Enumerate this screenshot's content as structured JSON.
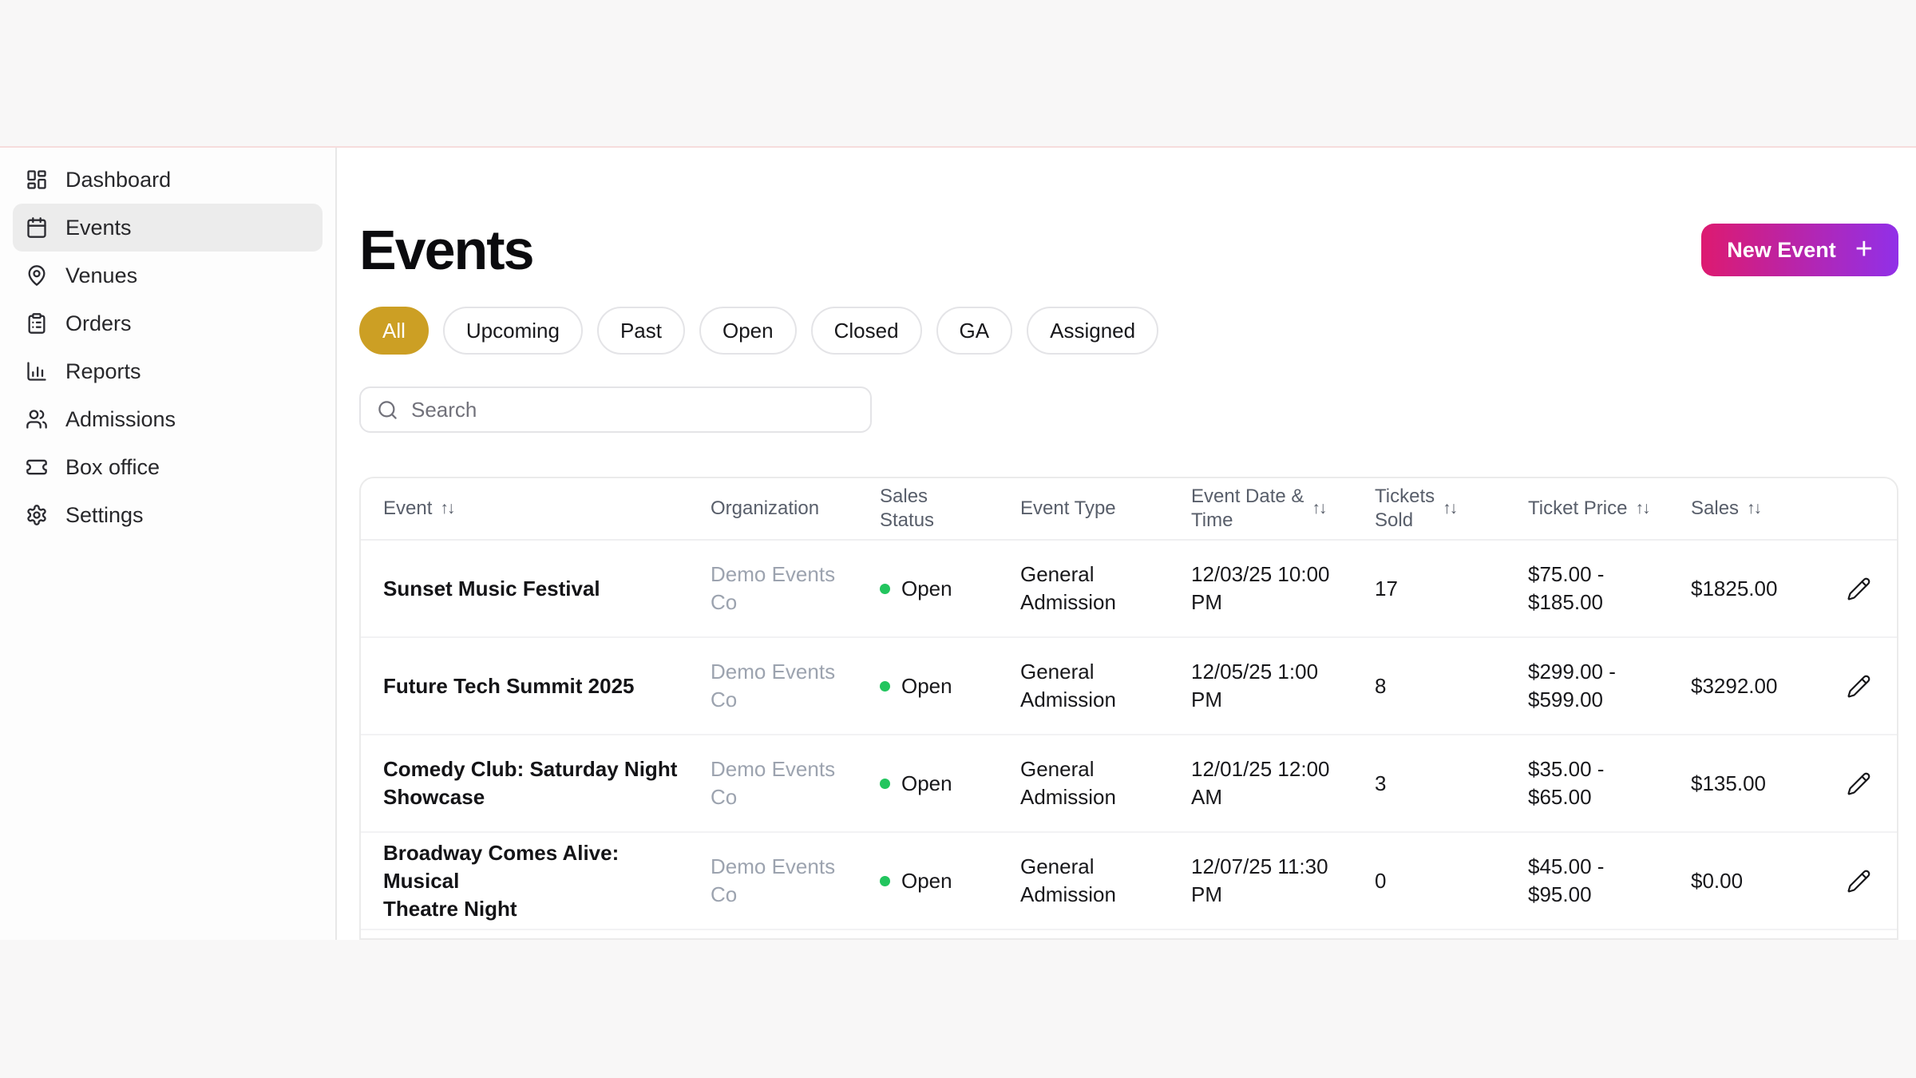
{
  "colors": {
    "accent_gold": "#cc9f24",
    "button_gradient_from": "#dd1a70",
    "button_gradient_to": "#9130e8",
    "status_open_green": "#22c55e",
    "top_divider_pink": "#f6dcdc"
  },
  "sidebar": {
    "items": [
      {
        "label": "Dashboard",
        "icon": "dashboard-icon",
        "active": false
      },
      {
        "label": "Events",
        "icon": "calendar-icon",
        "active": true
      },
      {
        "label": "Venues",
        "icon": "map-pin-icon",
        "active": false
      },
      {
        "label": "Orders",
        "icon": "clipboard-icon",
        "active": false
      },
      {
        "label": "Reports",
        "icon": "bar-chart-icon",
        "active": false
      },
      {
        "label": "Admissions",
        "icon": "users-icon",
        "active": false
      },
      {
        "label": "Box office",
        "icon": "ticket-icon",
        "active": false
      },
      {
        "label": "Settings",
        "icon": "gear-icon",
        "active": false
      }
    ]
  },
  "header": {
    "title": "Events",
    "new_event_label": "New Event",
    "new_event_plus": "+"
  },
  "filters": [
    {
      "label": "All",
      "active": true
    },
    {
      "label": "Upcoming",
      "active": false
    },
    {
      "label": "Past",
      "active": false
    },
    {
      "label": "Open",
      "active": false
    },
    {
      "label": "Closed",
      "active": false
    },
    {
      "label": "GA",
      "active": false
    },
    {
      "label": "Assigned",
      "active": false
    }
  ],
  "search": {
    "placeholder": "Search",
    "icon": "search-icon"
  },
  "table": {
    "sort_glyph": "↑↓",
    "columns": [
      {
        "label": "Event",
        "sortable": true
      },
      {
        "label": "Organization",
        "sortable": false
      },
      {
        "label": "Sales\nStatus",
        "sortable": false
      },
      {
        "label": "Event Type",
        "sortable": false
      },
      {
        "label": "Event Date &\nTime",
        "sortable": true
      },
      {
        "label": "Tickets\nSold",
        "sortable": true
      },
      {
        "label": "Ticket Price",
        "sortable": true
      },
      {
        "label": "Sales",
        "sortable": true
      }
    ],
    "rows": [
      {
        "event": "Sunset Music Festival",
        "organization": "Demo Events\nCo",
        "sales_status": "Open",
        "event_type": "General\nAdmission",
        "datetime": "12/03/25 10:00\nPM",
        "tickets_sold": "17",
        "ticket_price": "$75.00 -\n$185.00",
        "sales": "$1825.00"
      },
      {
        "event": "Future Tech Summit 2025",
        "organization": "Demo Events\nCo",
        "sales_status": "Open",
        "event_type": "General\nAdmission",
        "datetime": "12/05/25 1:00\nPM",
        "tickets_sold": "8",
        "ticket_price": "$299.00 -\n$599.00",
        "sales": "$3292.00"
      },
      {
        "event": "Comedy Club: Saturday Night\nShowcase",
        "organization": "Demo Events\nCo",
        "sales_status": "Open",
        "event_type": "General\nAdmission",
        "datetime": "12/01/25 12:00\nAM",
        "tickets_sold": "3",
        "ticket_price": "$35.00 -\n$65.00",
        "sales": "$135.00"
      },
      {
        "event": "Broadway Comes Alive: Musical\nTheatre Night",
        "organization": "Demo Events\nCo",
        "sales_status": "Open",
        "event_type": "General\nAdmission",
        "datetime": "12/07/25 11:30\nPM",
        "tickets_sold": "0",
        "ticket_price": "$45.00 -\n$95.00",
        "sales": "$0.00"
      }
    ]
  }
}
